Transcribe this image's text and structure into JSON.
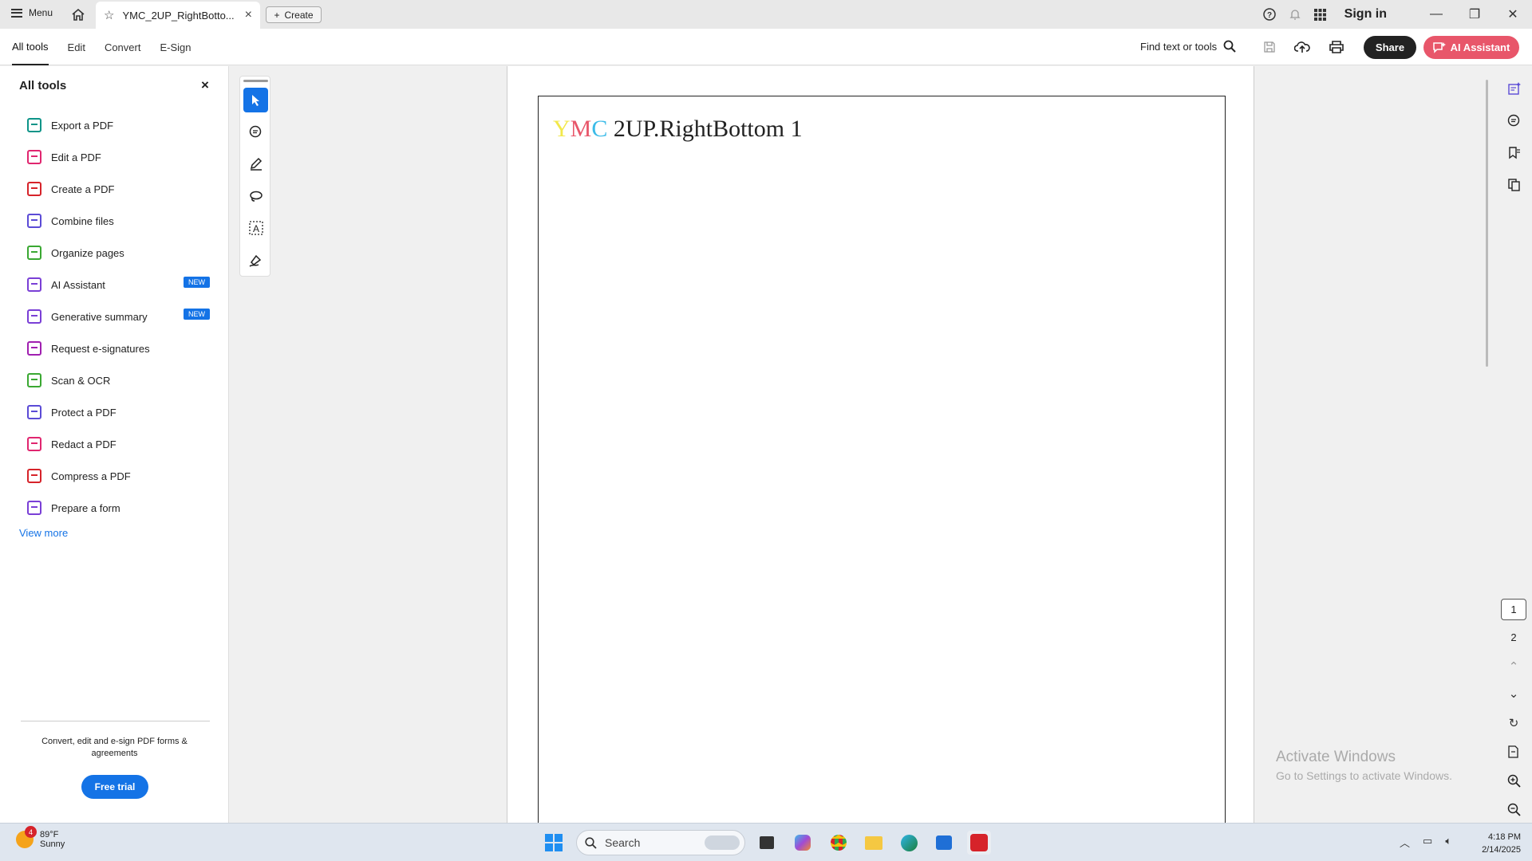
{
  "titlebar": {
    "menu_label": "Menu",
    "tab_title": "YMC_2UP_RightBotto...",
    "create_label": "Create",
    "signin_label": "Sign in"
  },
  "toolbar": {
    "menu_tabs": [
      "All tools",
      "Edit",
      "Convert",
      "E-Sign"
    ],
    "find_label": "Find text or tools",
    "share_label": "Share",
    "ai_label": "AI Assistant"
  },
  "left_panel": {
    "title": "All tools",
    "tools": [
      {
        "label": "Export a PDF",
        "icon": "export-pdf-icon",
        "color": "#0d9488"
      },
      {
        "label": "Edit a PDF",
        "icon": "edit-pdf-icon",
        "color": "#e0266f"
      },
      {
        "label": "Create a PDF",
        "icon": "create-pdf-icon",
        "color": "#d6232a"
      },
      {
        "label": "Combine files",
        "icon": "combine-files-icon",
        "color": "#5b4bd6"
      },
      {
        "label": "Organize pages",
        "icon": "organize-pages-icon",
        "color": "#3aa832"
      },
      {
        "label": "AI Assistant",
        "icon": "ai-assistant-icon",
        "color": "#7a3fd6",
        "badge": "NEW"
      },
      {
        "label": "Generative summary",
        "icon": "generative-summary-icon",
        "color": "#7a3fd6",
        "badge": "NEW"
      },
      {
        "label": "Request e-signatures",
        "icon": "request-esignatures-icon",
        "color": "#a01fb0"
      },
      {
        "label": "Scan & OCR",
        "icon": "scan-ocr-icon",
        "color": "#3aa832"
      },
      {
        "label": "Protect a PDF",
        "icon": "protect-pdf-icon",
        "color": "#5b4bd6"
      },
      {
        "label": "Redact a PDF",
        "icon": "redact-pdf-icon",
        "color": "#e0266f"
      },
      {
        "label": "Compress a PDF",
        "icon": "compress-pdf-icon",
        "color": "#d6232a"
      },
      {
        "label": "Prepare a form",
        "icon": "prepare-form-icon",
        "color": "#7a3fd6"
      }
    ],
    "view_more": "View more",
    "promo_text": "Convert, edit and e-sign PDF forms & agreements",
    "trial_label": "Free trial"
  },
  "document": {
    "title_y": "Y",
    "title_m": "M",
    "title_c": "C",
    "title_rest": " 2UP.RightBottom 1"
  },
  "right_rail": {
    "page_current": "1",
    "page_next": "2"
  },
  "watermark": {
    "line1": "Activate Windows",
    "line2": "Go to Settings to activate Windows."
  },
  "taskbar": {
    "weather_temp": "89°F",
    "weather_desc": "Sunny",
    "weather_badge": "4",
    "search_placeholder": "Search",
    "time": "4:18 PM",
    "date": "2/14/2025"
  },
  "colors": {
    "accent_blue": "#1473e6",
    "ai_pink": "#e8566a"
  }
}
